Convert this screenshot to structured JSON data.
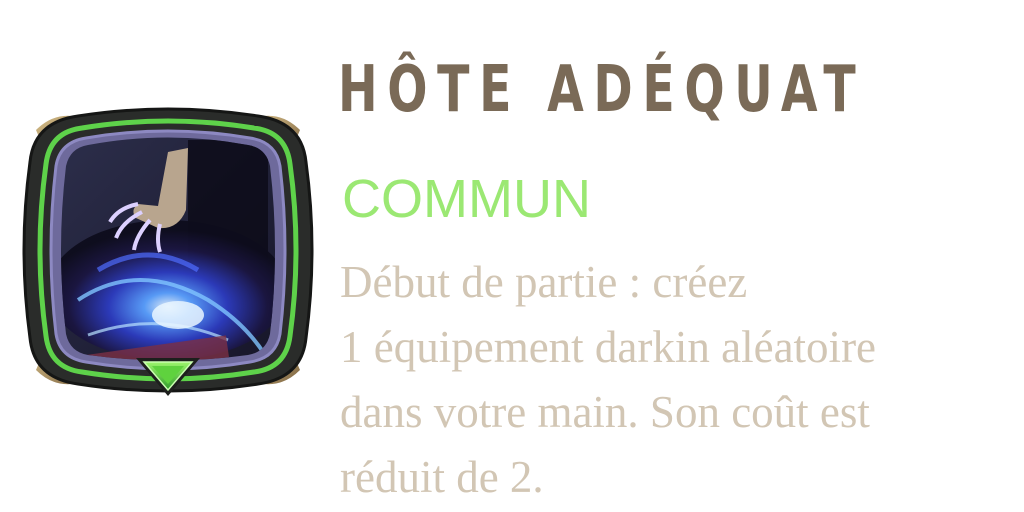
{
  "card": {
    "title": "HÔTE ADÉQUAT",
    "rarity": "COMMUN",
    "description_lines": [
      "Début de partie : créez",
      "1 équipement darkin aléatoire",
      "dans votre main. Son coût est",
      "réduit de 2."
    ],
    "icon": "darkin-hand-art-icon",
    "badge_icon": "green-triangle-rarity-icon"
  },
  "colors": {
    "title": "#7a6a57",
    "rarity": "#9be873",
    "description": "#d2c6b4",
    "frame_green": "#5ed24a",
    "frame_dark": "#2a2c2a",
    "frame_gold": "#a58a5e"
  }
}
